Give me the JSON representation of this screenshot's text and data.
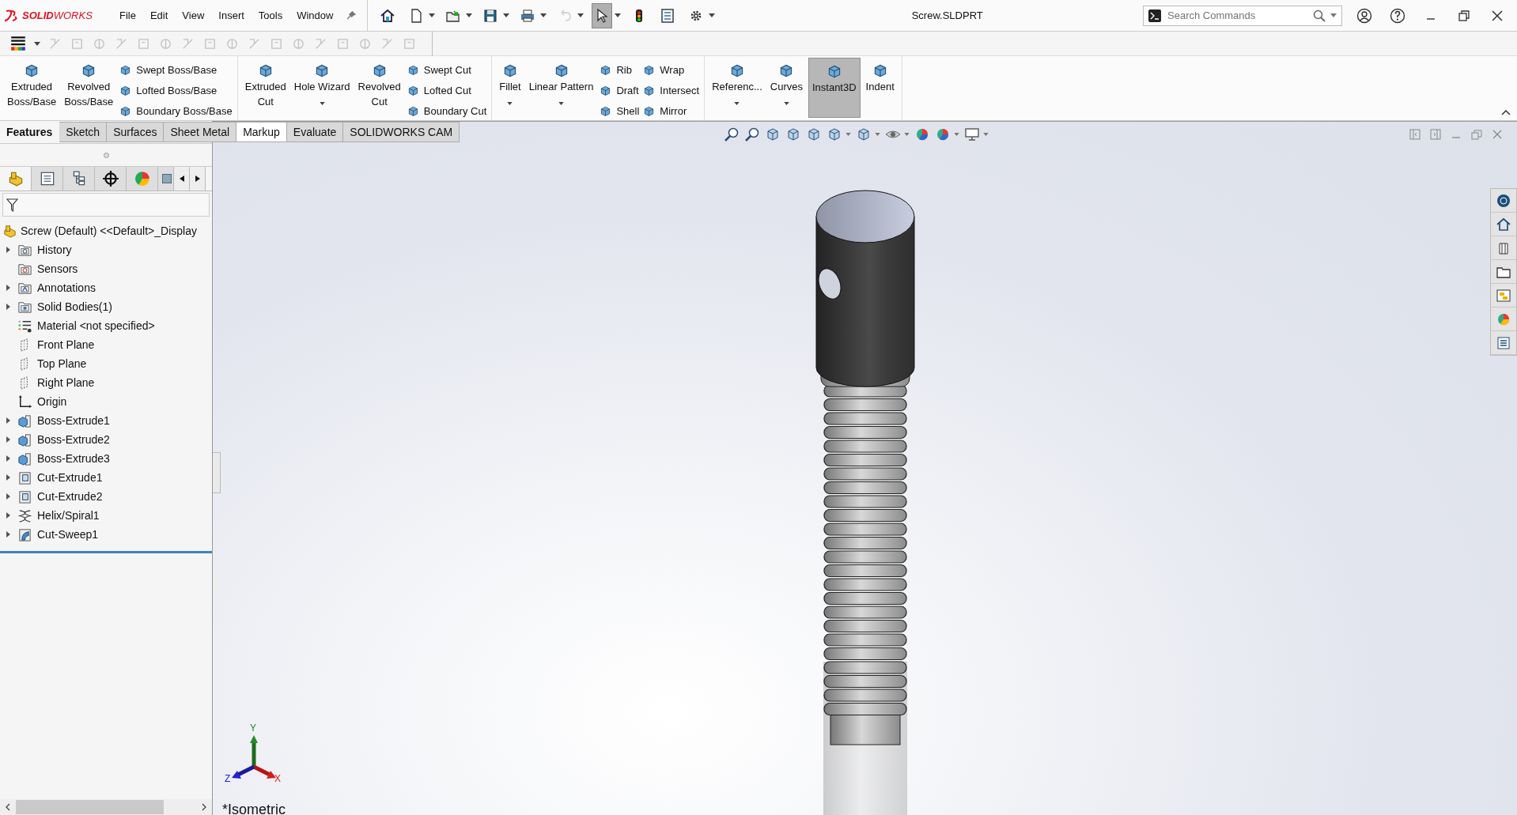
{
  "app": {
    "logo": "**SOLID**WORKS"
  },
  "menu": [
    "File",
    "Edit",
    "View",
    "Insert",
    "Tools",
    "Window"
  ],
  "quick_access": [
    {
      "kind": "home",
      "has_menu": false,
      "selected": false,
      "disabled": false
    },
    {
      "kind": "new",
      "has_menu": true,
      "selected": false,
      "disabled": false
    },
    {
      "kind": "open",
      "has_menu": true,
      "selected": false,
      "disabled": false
    },
    {
      "kind": "save",
      "has_menu": true,
      "selected": false,
      "disabled": false
    },
    {
      "kind": "print",
      "has_menu": true,
      "selected": false,
      "disabled": false
    },
    {
      "kind": "undo",
      "has_menu": true,
      "selected": false,
      "disabled": true
    },
    {
      "kind": "select",
      "has_menu": true,
      "selected": true,
      "disabled": false
    },
    {
      "kind": "rebuild",
      "has_menu": false,
      "selected": false,
      "disabled": false
    },
    {
      "kind": "properties",
      "has_menu": false,
      "selected": false,
      "disabled": false
    },
    {
      "kind": "options",
      "has_menu": true,
      "selected": false,
      "disabled": false
    }
  ],
  "window": {
    "title": "Screw.SLDPRT"
  },
  "search": {
    "placeholder": "Search Commands"
  },
  "ribbon": [
    [
      {
        "kind": "large",
        "label": "Extruded\nBoss/Base",
        "has_menu": false,
        "selected": false
      },
      {
        "kind": "large",
        "label": "Revolved\nBoss/Base",
        "has_menu": false,
        "selected": false
      },
      {
        "kind": "stack",
        "items": [
          "Swept Boss/Base",
          "Lofted Boss/Base",
          "Boundary Boss/Base"
        ]
      }
    ],
    [
      {
        "kind": "large",
        "label": "Extruded\nCut",
        "has_menu": false,
        "selected": false
      },
      {
        "kind": "large",
        "label": "Hole Wizard",
        "has_menu": true,
        "selected": false
      },
      {
        "kind": "large",
        "label": "Revolved\nCut",
        "has_menu": false,
        "selected": false
      },
      {
        "kind": "stack",
        "items": [
          "Swept Cut",
          "Lofted Cut",
          "Boundary Cut"
        ]
      }
    ],
    [
      {
        "kind": "large",
        "label": "Fillet",
        "has_menu": true,
        "selected": false
      },
      {
        "kind": "large",
        "label": "Linear Pattern",
        "has_menu": true,
        "selected": false
      },
      {
        "kind": "stack",
        "items": [
          "Rib",
          "Draft",
          "Shell"
        ]
      },
      {
        "kind": "stack",
        "items": [
          "Wrap",
          "Intersect",
          "Mirror"
        ]
      }
    ],
    [
      {
        "kind": "large",
        "label": "Referenc...",
        "has_menu": true,
        "selected": false
      },
      {
        "kind": "large",
        "label": "Curves",
        "has_menu": true,
        "selected": false
      },
      {
        "kind": "large",
        "label": "Instant3D",
        "has_menu": false,
        "selected": true
      },
      {
        "kind": "large",
        "label": "Indent",
        "has_menu": false,
        "selected": false
      }
    ]
  ],
  "command_tabs": [
    {
      "label": "Features",
      "selected": true,
      "hovered": false
    },
    {
      "label": "Sketch",
      "selected": false,
      "hovered": false
    },
    {
      "label": "Surfaces",
      "selected": false,
      "hovered": false
    },
    {
      "label": "Sheet Metal",
      "selected": false,
      "hovered": false
    },
    {
      "label": "Markup",
      "selected": false,
      "hovered": true
    },
    {
      "label": "Evaluate",
      "selected": false,
      "hovered": false
    },
    {
      "label": "SOLIDWORKS CAM",
      "selected": false,
      "hovered": false
    }
  ],
  "feature_tree": {
    "root": "Screw (Default) <<Default>_Display",
    "items": [
      {
        "kind": "history",
        "label": "History",
        "expandable": true
      },
      {
        "kind": "sensors",
        "label": "Sensors",
        "expandable": false
      },
      {
        "kind": "annotations",
        "label": "Annotations",
        "expandable": true
      },
      {
        "kind": "bodies",
        "label": "Solid Bodies(1)",
        "expandable": true
      },
      {
        "kind": "material",
        "label": "Material <not specified>",
        "expandable": false
      },
      {
        "kind": "plane",
        "label": "Front Plane",
        "expandable": false
      },
      {
        "kind": "plane",
        "label": "Top Plane",
        "expandable": false
      },
      {
        "kind": "plane",
        "label": "Right Plane",
        "expandable": false
      },
      {
        "kind": "origin",
        "label": "Origin",
        "expandable": false
      },
      {
        "kind": "boss",
        "label": "Boss-Extrude1",
        "expandable": true
      },
      {
        "kind": "boss",
        "label": "Boss-Extrude2",
        "expandable": true
      },
      {
        "kind": "boss",
        "label": "Boss-Extrude3",
        "expandable": true
      },
      {
        "kind": "cut",
        "label": "Cut-Extrude1",
        "expandable": true
      },
      {
        "kind": "cut",
        "label": "Cut-Extrude2",
        "expandable": true
      },
      {
        "kind": "helix",
        "label": "Helix/Spiral1",
        "expandable": true
      },
      {
        "kind": "sweep",
        "label": "Cut-Sweep1",
        "expandable": true
      }
    ]
  },
  "viewport": {
    "view_name": "*Isometric",
    "triad": {
      "x": "X",
      "y": "Y",
      "z": "Z"
    }
  }
}
